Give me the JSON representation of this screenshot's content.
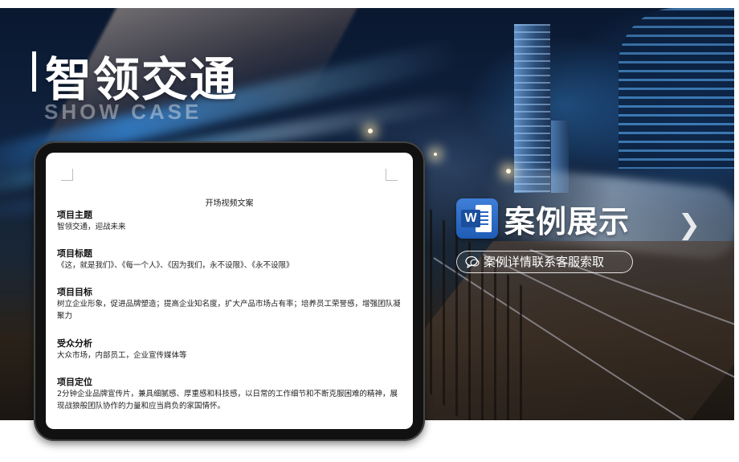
{
  "header": {
    "title": "智领交通",
    "subtitle": "SHOW CASE"
  },
  "document": {
    "title": "开场视频文案",
    "sections": [
      {
        "heading": "项目主题",
        "body": "智领交通，迎战未来"
      },
      {
        "heading": "项目标题",
        "body": "《这，就是我们》、《每一个人》、《因为我们，永不设限》、《永不设限》"
      },
      {
        "heading": "项目目标",
        "body": "树立企业形象，促进品牌塑造；提高企业知名度，扩大产品市场占有率；培养员工荣誉感，增强团队凝聚力"
      },
      {
        "heading": "受众分析",
        "body": "大众市场，内部员工，企业宣传媒体等"
      },
      {
        "heading": "项目定位",
        "body": "2分钟企业品牌宣传片，兼具细腻感、厚重感和科技感，以日常的工作细节和不断克服困难的精神，展现战狼般团队协作的力量和应当肩负的家国情怀。"
      }
    ]
  },
  "case_display": {
    "icon": "word-document-icon",
    "icon_letter": "W",
    "title": "案例展示",
    "contact": "案例详情联系客服索取",
    "next_icon": "chevron-right-icon"
  },
  "colors": {
    "word_blue": "#2a67c4",
    "text_white": "#ffffff"
  }
}
